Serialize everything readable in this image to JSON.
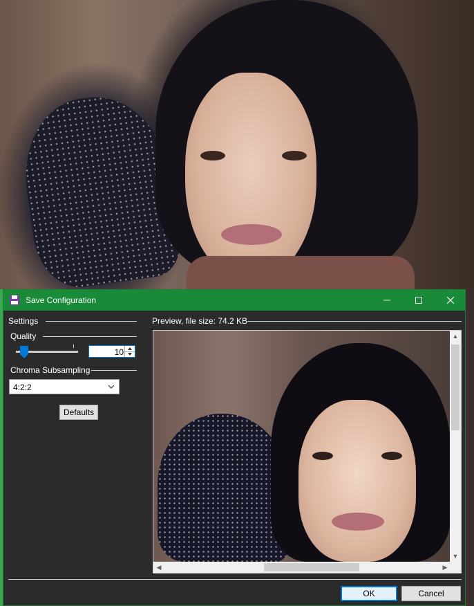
{
  "window": {
    "title": "Save Configuration",
    "controls": {
      "minimize": "minimize",
      "maximize": "maximize",
      "close": "close"
    }
  },
  "settings": {
    "section_label": "Settings",
    "quality_label": "Quality",
    "quality_value": "10",
    "chroma_label": "Chroma Subsampling",
    "chroma_value": "4:2:2",
    "defaults_button": "Defaults"
  },
  "preview": {
    "label": "Preview, file size: 74.2 KB"
  },
  "footer": {
    "ok_button": "OK",
    "cancel_button": "Cancel"
  },
  "colors": {
    "titlebar": "#188a38",
    "dialog_bg": "#2b2b2b",
    "accent": "#0078d7"
  }
}
